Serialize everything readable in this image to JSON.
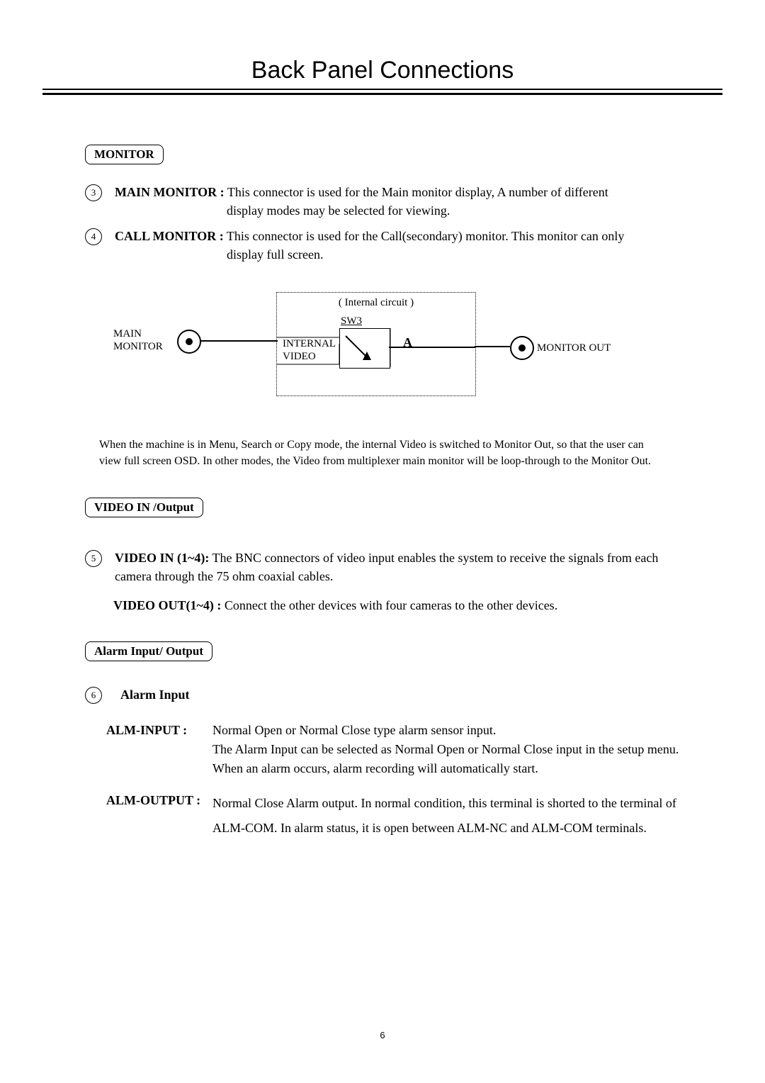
{
  "page_title": "Back Panel Connections",
  "sections": {
    "monitor": {
      "badge": "MONITOR",
      "items": {
        "main_monitor": {
          "num": "3",
          "label": "MAIN MONITOR :",
          "text_line1": " This connector is used for the Main monitor display, A number of different",
          "text_line2": "display modes may be selected for viewing."
        },
        "call_monitor": {
          "num": "4",
          "label": "CALL MONITOR :",
          "text_line1": " This connector is used for the Call(secondary) monitor. This monitor can only",
          "text_line2": "display full screen."
        }
      },
      "diagram": {
        "main_monitor_label": "MAIN\nMONITOR",
        "internal_circuit_label": "( Internal circuit )",
        "sw3_label": "SW3",
        "internal_video_label": "INTERNAL\nVIDEO",
        "a_label": "A",
        "monitor_out_label": "MONITOR OUT"
      },
      "note": "When the machine is in Menu, Search or Copy mode, the internal Video is switched to Monitor Out, so that the user can view full screen OSD.  In other modes, the Video from multiplexer main monitor will be loop-through to the Monitor Out."
    },
    "video_io": {
      "badge": "VIDEO  IN /Output",
      "video_in": {
        "num": "5",
        "label": "VIDEO IN (1~4):",
        "text": " The BNC connectors of video input enables the system to receive the signals from each camera through the 75 ohm coaxial cables."
      },
      "video_out": {
        "label": "VIDEO OUT(1~4) :",
        "text": " Connect the other devices with four cameras to the other devices."
      }
    },
    "alarm": {
      "badge": "Alarm Input/ Output",
      "alarm_input_num": "6",
      "alarm_input_head": "Alarm Input",
      "alm_input": {
        "label": "ALM-INPUT :",
        "text": "Normal Open or Normal Close type alarm sensor input.\nThe Alarm Input can be selected as Normal Open or Normal Close input in the setup menu. When an alarm occurs, alarm recording will automatically start."
      },
      "alm_output": {
        "label": "ALM-OUTPUT :",
        "text": "Normal Close Alarm output. In normal condition, this terminal is shorted to the terminal of ALM-COM. In alarm status, it is open between ALM-NC and ALM-COM terminals."
      }
    }
  },
  "page_number": "6"
}
